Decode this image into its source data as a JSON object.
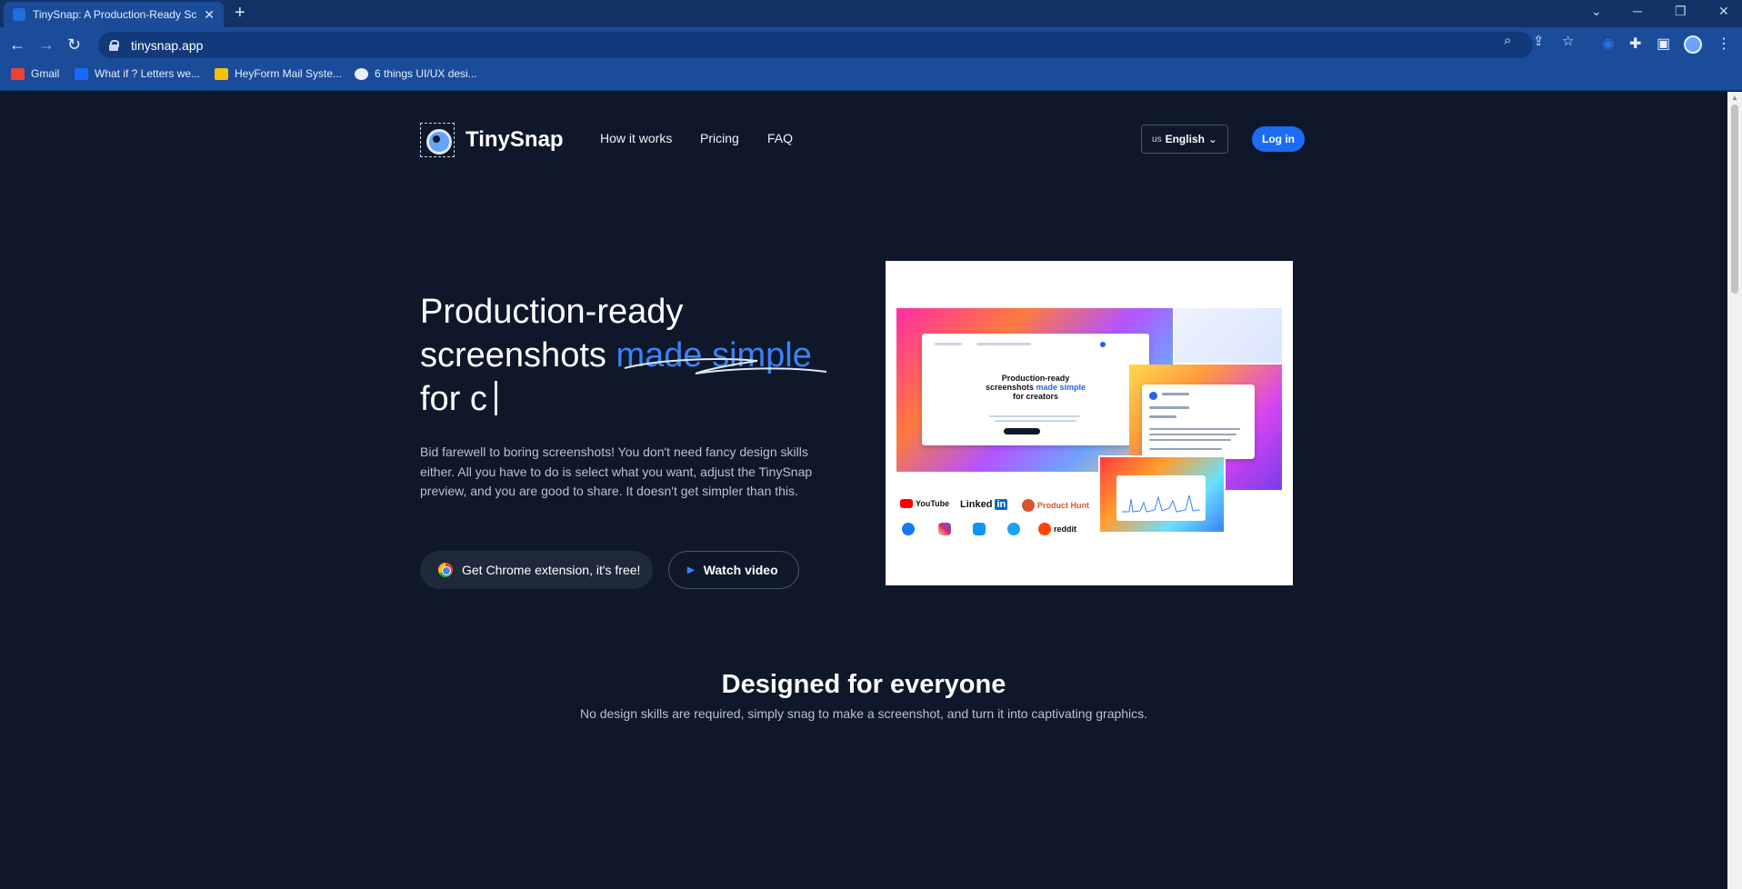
{
  "browser": {
    "tab_title": "TinySnap: A Production-Ready Sc",
    "url": "tinysnap.app",
    "bookmarks": [
      {
        "label": "Gmail",
        "color": "#ea4335"
      },
      {
        "label": "What if ? Letters we...",
        "color": "#1769ff"
      },
      {
        "label": "HeyForm Mail Syste...",
        "color": "#f4c20d"
      },
      {
        "label": "6 things UI/UX desi...",
        "color": "#e8eefc"
      }
    ],
    "colors": {
      "tabbar": "#113366",
      "toolbar": "#1a4c9a"
    }
  },
  "header": {
    "brand": "TinySnap",
    "nav": [
      "How it works",
      "Pricing",
      "FAQ"
    ],
    "lang_code": "us",
    "lang_label": "English",
    "login_label": "Log in",
    "accent": "#1d6bf0"
  },
  "hero": {
    "title_line1": "Production-ready",
    "title_line2_plain": "screenshots ",
    "title_line2_highlight": "made simple",
    "title_line3": "for c",
    "description": "Bid farewell to boring screenshots! You don't need fancy design skills either. All you have to do is select what you want, adjust the TinySnap preview, and you are good to share. It doesn't get simpler than this.",
    "primary_button": "Get Chrome extension, it's free!",
    "secondary_button": "Watch video",
    "highlight_color": "#3b82f6"
  },
  "preview": {
    "card_title_line1": "Production-ready",
    "card_title_line2a": "screenshots ",
    "card_title_line2b": "made simple",
    "card_title_line3": "for creators",
    "social": [
      "YouTube",
      "Linked",
      "in",
      "Product Hunt",
      "reddit"
    ]
  },
  "section": {
    "title": "Designed for everyone",
    "subtitle": "No design skills are required, simply snag to make a screenshot, and turn it into captivating graphics."
  }
}
